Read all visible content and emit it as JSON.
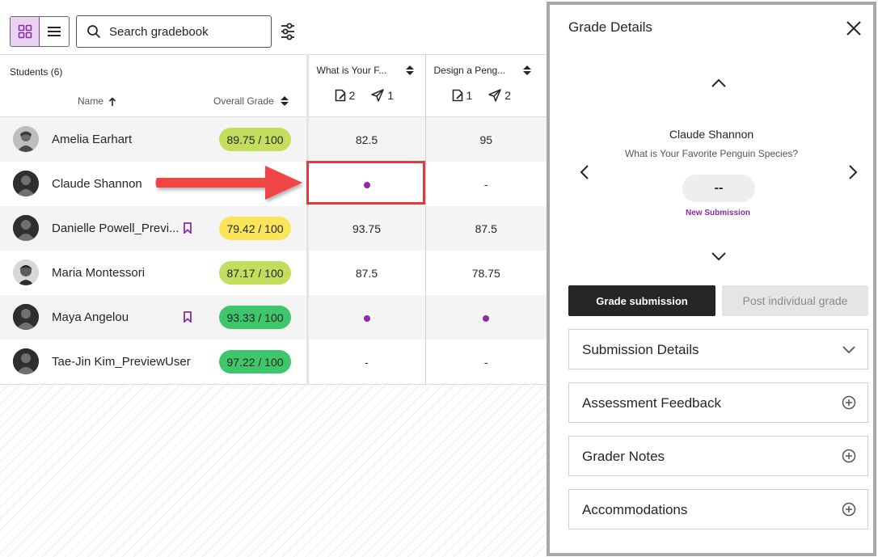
{
  "toolbar": {
    "search_placeholder": "Search gradebook",
    "grid_view_icon": "grid-icon",
    "list_view_icon": "list-icon",
    "filter_icon": "filter-sliders-icon"
  },
  "table": {
    "students_header": "Students (6)",
    "name_header": "Name",
    "overall_header": "Overall Grade",
    "columns": [
      {
        "title": "What is Your F...",
        "needs_grading": "2",
        "submitted": "1"
      },
      {
        "title": "Design a Peng...",
        "needs_grading": "1",
        "submitted": "2"
      }
    ],
    "rows": [
      {
        "name": "Amelia Earhart",
        "overall": "89.75 / 100",
        "pill": "lime",
        "bookmark": false,
        "a": "82.5",
        "b": "95"
      },
      {
        "name": "Claude Shannon",
        "overall": "",
        "pill": "",
        "bookmark": false,
        "a": "",
        "a_dot": true,
        "b": "-"
      },
      {
        "name": "Danielle Powell_Previ...",
        "overall": "79.42 / 100",
        "pill": "yellow",
        "bookmark": true,
        "a": "93.75",
        "b": "87.5"
      },
      {
        "name": "Maria Montessori",
        "overall": "87.17 / 100",
        "pill": "lime",
        "bookmark": false,
        "a": "87.5",
        "b": "78.75"
      },
      {
        "name": "Maya Angelou",
        "overall": "93.33 / 100",
        "pill": "green",
        "bookmark": true,
        "a": "",
        "a_dot": true,
        "b": "",
        "b_dot": true
      },
      {
        "name": "Tae-Jin Kim_PreviewUser",
        "overall": "97.22 / 100",
        "pill": "green",
        "bookmark": false,
        "a": "-",
        "b": "-"
      }
    ]
  },
  "panel": {
    "title": "Grade Details",
    "student": "Claude Shannon",
    "item": "What is Your Favorite Penguin Species?",
    "grade": "--",
    "status": "New Submission",
    "grade_button": "Grade submission",
    "post_button": "Post individual grade",
    "sections": [
      {
        "label": "Submission Details",
        "icon": "chevron-down-icon"
      },
      {
        "label": "Assessment Feedback",
        "icon": "plus-circle-icon"
      },
      {
        "label": "Grader Notes",
        "icon": "plus-circle-icon"
      },
      {
        "label": "Accommodations",
        "icon": "plus-circle-icon"
      }
    ]
  },
  "colors": {
    "accent": "#8c2aa8",
    "pill_lime": "#c4dd5c",
    "pill_yellow": "#fbe35a",
    "pill_green": "#3ec66b",
    "highlight": "#e8383b"
  }
}
